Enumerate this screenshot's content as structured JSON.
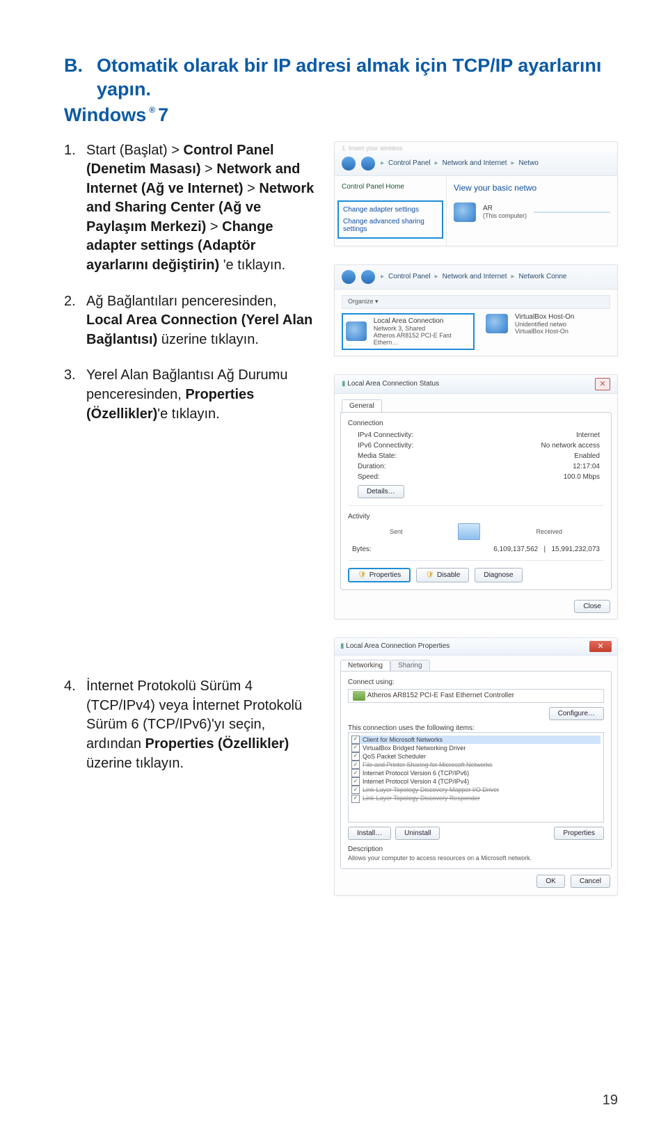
{
  "section": {
    "label": "B.",
    "title": "Otomatik olarak bir IP adresi almak için TCP/IP ayarlarını yapın.",
    "subtitle_main": "Windows",
    "subtitle_ver": "7",
    "reg": "®"
  },
  "steps": {
    "s1": {
      "num": "1.",
      "text_pre": "Start (Başlat) > ",
      "b1": "Control Panel (Denetim Masası)",
      "mid1": " > ",
      "b2": "Network and Internet (Ağ ve Internet)",
      "mid2": " > ",
      "b3": "Network and Sharing Center (Ağ ve Paylaşım Merkezi)",
      "mid3": " > ",
      "b4": "Change adapter settings (Adaptör ayarlarını değiştirin)",
      "tail": " 'e tıklayın."
    },
    "s2": {
      "num": "2.",
      "pre": "Ağ Bağlantıları penceresinden, ",
      "b": "Local Area Connection (Yerel Alan Bağlantısı)",
      "tail": " üzerine tıklayın."
    },
    "s3": {
      "num": "3.",
      "pre": "Yerel Alan Bağlantısı Ağ Durumu penceresinden, ",
      "b": "Properties (Özellikler)",
      "tail": "'e tıklayın."
    },
    "s4": {
      "num": "4.",
      "pre": "İnternet Protokolü Sürüm 4 (TCP/IPv4) veya İnternet Protokolü Sürüm 6 (TCP/IPv6)'yı seçin, ardından ",
      "b": "Properties (Özellikler)",
      "tail": " üzerine tıklayın."
    }
  },
  "shot1": {
    "blur_title": "1. Insert your wireless",
    "crumbs": [
      "Control Panel",
      "Network and Internet",
      "Netwo"
    ],
    "cp_home": "Control Panel Home",
    "change_adapter": "Change adapter settings",
    "change_adv": "Change advanced sharing settings",
    "view_basic": "View your basic netwo",
    "ar_name": "AR",
    "ar_sub": "(This computer)"
  },
  "shot2": {
    "crumbs": [
      "Control Panel",
      "Network and Internet",
      "Network Conne"
    ],
    "organize": "Organize ▾",
    "lac": "Local Area Connection",
    "lac_l2": "Network 3, Shared",
    "lac_l3": "Atheros AR8152 PCI-E Fast Ethern…",
    "vb": "VirtualBox Host-On",
    "vb_l2": "Unidentified netwo",
    "vb_l3": "VirtualBox Host-On"
  },
  "shot3": {
    "title": "Local Area Connection Status",
    "tab": "General",
    "grp1": "Connection",
    "kv": [
      {
        "k": "IPv4 Connectivity:",
        "v": "Internet"
      },
      {
        "k": "IPv6 Connectivity:",
        "v": "No network access"
      },
      {
        "k": "Media State:",
        "v": "Enabled"
      },
      {
        "k": "Duration:",
        "v": "12:17:04"
      },
      {
        "k": "Speed:",
        "v": "100.0 Mbps"
      }
    ],
    "details": "Details…",
    "grp2": "Activity",
    "sent_lbl": "Sent",
    "recv_lbl": "Received",
    "bytes_lbl": "Bytes:",
    "sent": "6,109,137,562",
    "recv": "15,991,232,073",
    "btn_props": "Properties",
    "btn_disable": "Disable",
    "btn_diag": "Diagnose",
    "btn_close": "Close"
  },
  "shot4": {
    "title": "Local Area Connection Properties",
    "tab_net": "Networking",
    "tab_share": "Sharing",
    "connect_using": "Connect using:",
    "nic": "Atheros AR8152 PCI-E Fast Ethernet Controller",
    "configure": "Configure…",
    "uses": "This connection uses the following items:",
    "items": [
      {
        "t": "Client for Microsoft Networks",
        "sel": true,
        "strike": false
      },
      {
        "t": "VirtualBox Bridged Networking Driver",
        "sel": false,
        "strike": false
      },
      {
        "t": "QoS Packet Scheduler",
        "sel": false,
        "strike": false
      },
      {
        "t": "File and Printer Sharing for Microsoft Networks",
        "sel": false,
        "strike": true
      },
      {
        "t": "Internet Protocol Version 6 (TCP/IPv6)",
        "sel": false,
        "strike": false
      },
      {
        "t": "Internet Protocol Version 4 (TCP/IPv4)",
        "sel": false,
        "strike": false
      },
      {
        "t": "Link-Layer Topology Discovery Mapper I/O Driver",
        "sel": false,
        "strike": true
      },
      {
        "t": "Link-Layer Topology Discovery Responder",
        "sel": false,
        "strike": true
      }
    ],
    "install": "Install…",
    "uninstall": "Uninstall",
    "props": "Properties",
    "desc_lbl": "Description",
    "desc": "Allows your computer to access resources on a Microsoft network.",
    "ok": "OK",
    "cancel": "Cancel"
  },
  "page_number": "19"
}
